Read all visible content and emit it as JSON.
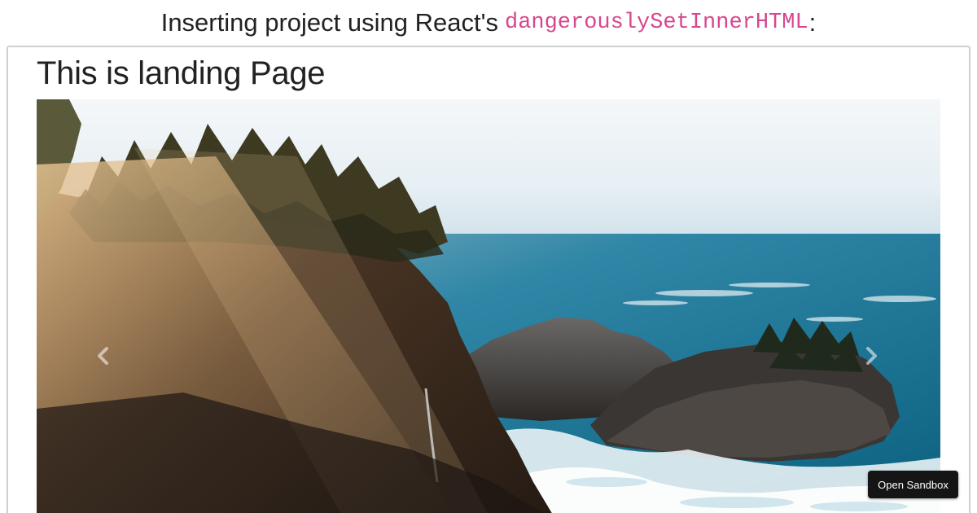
{
  "header": {
    "prefix": "Inserting project using React's",
    "code": "dangerouslySetInnerHTML",
    "suffix": ":"
  },
  "landing": {
    "title": "This is landing Page"
  },
  "carousel": {
    "image": "coastal-cliff-photo",
    "prev_icon": "chevron-left-icon",
    "next_icon": "chevron-right-icon"
  },
  "sandbox_button": {
    "label": "Open Sandbox"
  },
  "colors": {
    "code_accent": "#d6488e",
    "frame_border": "#cfcfcf",
    "button_bg": "#151515",
    "sea": "#0c6c8c",
    "sky": "#eef4f8"
  }
}
